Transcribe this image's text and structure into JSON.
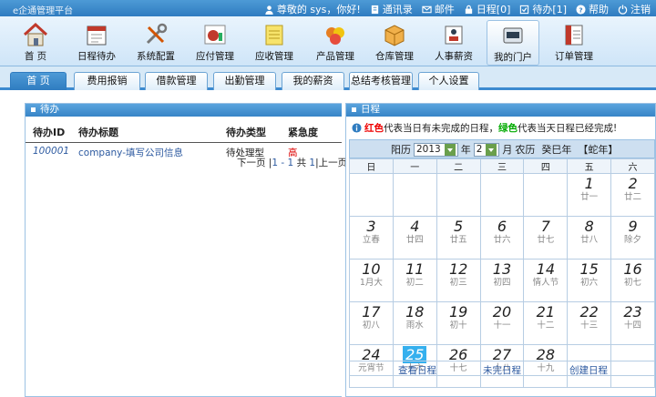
{
  "app": {
    "title": "e企通管理平台"
  },
  "toplinks": [
    {
      "icon": "user-icon",
      "label": "尊敬的 sys，你好!"
    },
    {
      "icon": "address-book-icon",
      "label": "通讯录"
    },
    {
      "icon": "mail-icon",
      "label": "邮件"
    },
    {
      "icon": "lock-icon",
      "label": "日程[0]"
    },
    {
      "icon": "task-icon",
      "label": "待办[1]"
    },
    {
      "icon": "help-icon",
      "label": "帮助"
    },
    {
      "icon": "logout-icon",
      "label": "注销"
    }
  ],
  "toolbar": [
    {
      "label": "首 页",
      "icon": "home-icon"
    },
    {
      "label": "日程待办",
      "icon": "calendar-icon"
    },
    {
      "label": "系统配置",
      "icon": "tools-icon"
    },
    {
      "label": "应付管理",
      "icon": "chart-icon"
    },
    {
      "label": "应收管理",
      "icon": "notepad-icon"
    },
    {
      "label": "产品管理",
      "icon": "product-icon"
    },
    {
      "label": "仓库管理",
      "icon": "box-icon"
    },
    {
      "label": "人事薪资",
      "icon": "personnel-icon"
    },
    {
      "label": "我的门户",
      "icon": "portal-icon",
      "active": true
    },
    {
      "label": "订单管理",
      "icon": "order-icon"
    }
  ],
  "tabs": [
    "首 页",
    "费用报销",
    "借款管理",
    "出勤管理",
    "我的薪资",
    "总结考核管理",
    "个人设置"
  ],
  "todo": {
    "title": "待办",
    "columns": [
      "待办ID",
      "待办标题",
      "待办类型",
      "紧急度"
    ],
    "rows": [
      {
        "id": "100001",
        "title": "company-填写公司信息",
        "type": "待处理型",
        "urgency": "高"
      }
    ],
    "pager": {
      "next": "下一页",
      "sep1": "|",
      "range": "1 - 1",
      "total_label": "共",
      "count": "1",
      "sep2": "|",
      "prev": "上一页"
    }
  },
  "calendar": {
    "title": "日程",
    "note": {
      "red": "红色",
      "mid": "代表当日有未完成的日程，",
      "green": "绿色",
      "end": "代表当天日程已经完成!"
    },
    "header": {
      "solar_label": "阳历",
      "year": "2013",
      "year_unit": "年",
      "month": "2",
      "month_unit": "月",
      "lunar_label": "农历",
      "lunar_year": "癸巳年",
      "zodiac": "【蛇年】"
    },
    "weekdays": [
      "日",
      "一",
      "二",
      "三",
      "四",
      "五",
      "六"
    ],
    "weeks": [
      [
        null,
        null,
        null,
        null,
        null,
        {
          "d": "1",
          "l": "廿一"
        },
        {
          "d": "2",
          "l": "廿二"
        }
      ],
      [
        {
          "d": "3",
          "l": "立春"
        },
        {
          "d": "4",
          "l": "廿四"
        },
        {
          "d": "5",
          "l": "廿五"
        },
        {
          "d": "6",
          "l": "廿六"
        },
        {
          "d": "7",
          "l": "廿七"
        },
        {
          "d": "8",
          "l": "廿八"
        },
        {
          "d": "9",
          "l": "除夕"
        }
      ],
      [
        {
          "d": "10",
          "l": "1月大"
        },
        {
          "d": "11",
          "l": "初二"
        },
        {
          "d": "12",
          "l": "初三"
        },
        {
          "d": "13",
          "l": "初四"
        },
        {
          "d": "14",
          "l": "情人节"
        },
        {
          "d": "15",
          "l": "初六"
        },
        {
          "d": "16",
          "l": "初七"
        }
      ],
      [
        {
          "d": "17",
          "l": "初八"
        },
        {
          "d": "18",
          "l": "雨水"
        },
        {
          "d": "19",
          "l": "初十"
        },
        {
          "d": "20",
          "l": "十一"
        },
        {
          "d": "21",
          "l": "十二"
        },
        {
          "d": "22",
          "l": "十三"
        },
        {
          "d": "23",
          "l": "十四"
        }
      ],
      [
        {
          "d": "24",
          "l": "元宵节"
        },
        {
          "d": "25",
          "l": "十六",
          "today": true
        },
        {
          "d": "26",
          "l": "十七"
        },
        {
          "d": "27",
          "l": "十八"
        },
        {
          "d": "28",
          "l": "十九"
        },
        null,
        null
      ]
    ],
    "footer": [
      "查看日程",
      "未完日程",
      "创建日程"
    ]
  },
  "colors": {
    "accent": "#3784c7",
    "today": "#35b0ee",
    "urgent": "#dd0000"
  }
}
